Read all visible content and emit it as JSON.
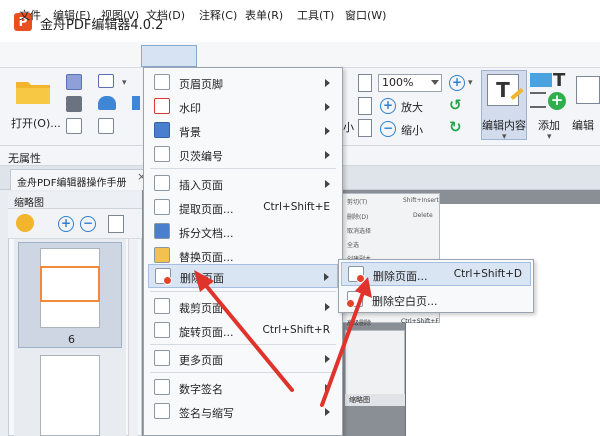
{
  "app": {
    "logo_text": "P",
    "title": "金舟PDF编辑器4.0.2"
  },
  "menubar": {
    "items": [
      "文件",
      "编辑(E)",
      "视图(V)",
      "文档(D)",
      "注释(C)",
      "表单(R)",
      "工具(T)",
      "窗口(W)"
    ]
  },
  "ribbon": {
    "open_label": "打开(O)...",
    "zoom_value": "100%",
    "zoom_in_label": "放大",
    "zoom_out_label": "缩小",
    "small_label": "小",
    "edit_content_label": "编辑内容",
    "add_label": "添加",
    "edit_label": "编辑",
    "icon_text_T": "T"
  },
  "propbar": {
    "text": "无属性"
  },
  "doc_tab": {
    "title": "金舟PDF编辑器操作手册",
    "close": "×"
  },
  "thumbnails": {
    "header": "缩略图",
    "page_number": "6"
  },
  "doc_menu": {
    "items": [
      {
        "label": "页眉页脚",
        "shortcut": "",
        "submenu": true
      },
      {
        "label": "水印",
        "shortcut": "",
        "submenu": true
      },
      {
        "label": "背景",
        "shortcut": "",
        "submenu": true
      },
      {
        "label": "贝茨编号",
        "shortcut": "",
        "submenu": true
      },
      {
        "label": "插入页面",
        "shortcut": "",
        "submenu": true
      },
      {
        "label": "提取页面...",
        "shortcut": "Ctrl+Shift+E",
        "submenu": false
      },
      {
        "label": "拆分文档...",
        "shortcut": "",
        "submenu": false
      },
      {
        "label": "替换页面...",
        "shortcut": "",
        "submenu": false
      },
      {
        "label": "删除页面",
        "shortcut": "",
        "submenu": true
      },
      {
        "label": "裁剪页面",
        "shortcut": "",
        "submenu": true
      },
      {
        "label": "旋转页面...",
        "shortcut": "Ctrl+Shift+R",
        "submenu": false
      },
      {
        "label": "更多页面",
        "shortcut": "",
        "submenu": true
      },
      {
        "label": "数字签名",
        "shortcut": "",
        "submenu": true
      },
      {
        "label": "签名与缩写",
        "shortcut": "",
        "submenu": true
      }
    ]
  },
  "delete_submenu": {
    "items": [
      {
        "label": "删除页面...",
        "shortcut": "Ctrl+Shift+D"
      },
      {
        "label": "删除空白页..."
      }
    ]
  },
  "bg_popup": {
    "lines": [
      "剪切(T)",
      "删除(D)",
      "取消选择",
      "全选",
      "创建副本"
    ],
    "shortcut1": "Shift+Insert",
    "shortcut2": "Delete",
    "bottom_row": "高级删除",
    "bottom_shortcut": "Ctrl+Shift+F",
    "thumb_caption": "缩略图"
  },
  "colors": {
    "accent": "#2f7fd0",
    "highlight": "#d9e5f3",
    "arrow_red": "#e0332c",
    "logo": "#e8501f"
  }
}
